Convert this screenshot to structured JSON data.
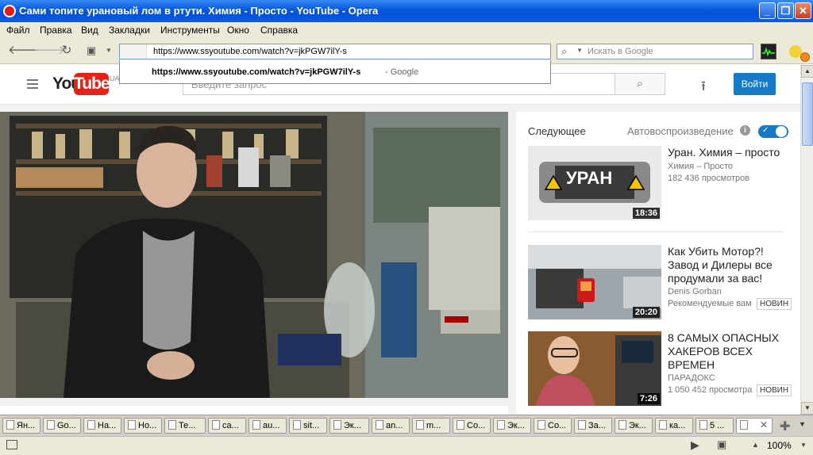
{
  "window": {
    "title": "Сами топите урановый лом в ртути. Химия - Просто - YouTube - Opera",
    "controls": {
      "minimize": "_",
      "maximize": "❐",
      "close": "✕"
    }
  },
  "menu": [
    "Файл",
    "Правка",
    "Вид",
    "Закладки",
    "Инструменты",
    "Окно",
    "Справка"
  ],
  "toolbar": {
    "url": "https://www.ssyoutube.com/watch?v=jkPGW7ilY-s",
    "search_placeholder": "Искать в Google"
  },
  "url_suggestion": {
    "url": "https://www.ssyoutube.com/watch?v=jkPGW7ilY-s",
    "source": "- Google"
  },
  "youtube": {
    "logo_you": "You",
    "logo_tube": "Tube",
    "region": "UA",
    "search_placeholder": "Введите запрос",
    "signin": "Войти"
  },
  "sidebar": {
    "next_label": "Следующее",
    "autoplay_label": "Автовоспроизведение",
    "autoplay_on": true,
    "videos": [
      {
        "title": "Уран. Химия – просто",
        "channel": "Химия – Просто",
        "views": "182 436 просмотров",
        "badge": "",
        "duration": "18:36",
        "thumb_text": "УРАН"
      },
      {
        "title": "Как Убить Мотор?! Завод и Дилеры все продумали за вас!",
        "channel": "Denis Gorban",
        "views": "Рекомендуемые вам",
        "badge": "НОВИН",
        "duration": "20:20",
        "thumb_text": ""
      },
      {
        "title": "8 САМЫХ ОПАСНЫХ ХАКЕРОВ ВСЕХ ВРЕМЕН",
        "channel": "ПАРАДОКС",
        "views": "1 050 452 просмотра",
        "badge": "НОВИН",
        "duration": "7:26",
        "thumb_text": ""
      }
    ]
  },
  "tabs": [
    "Ян...",
    "Go...",
    "На...",
    "Но...",
    "Те...",
    "са...",
    "au...",
    "sit...",
    "Эк...",
    "an...",
    "m...",
    "Co...",
    "Эк...",
    "Со...",
    "За...",
    "Эк...",
    "ка...",
    "5 ...",
    ""
  ],
  "status": {
    "zoom": "100%"
  },
  "colors": {
    "accent": "#167ac6",
    "youtube_red": "#e62117",
    "titlebar": "#0a5ce0"
  }
}
